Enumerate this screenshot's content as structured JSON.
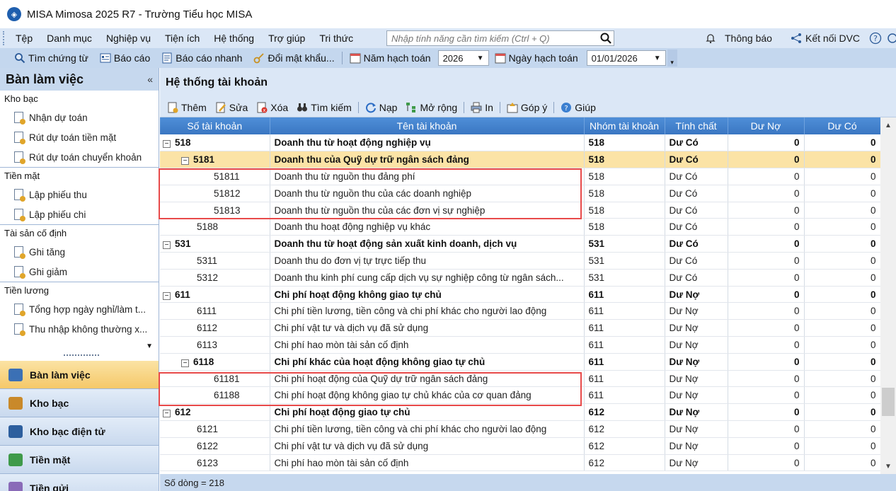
{
  "window": {
    "title": "MISA Mimosa 2025 R7 - Trường Tiểu học MISA"
  },
  "menu": {
    "items": [
      "Tệp",
      "Danh mục",
      "Nghiệp vụ",
      "Tiện ích",
      "Hệ thống",
      "Trợ giúp",
      "Tri thức"
    ],
    "search_placeholder": "Nhập tính năng cần tìm kiếm (Ctrl + Q)",
    "notifications": "Thông báo",
    "connect": "Kết nối DVC"
  },
  "toolbar2": {
    "find_voucher": "Tìm chứng từ",
    "report": "Báo cáo",
    "quick_report": "Báo cáo nhanh",
    "change_password": "Đổi mật khẩu...",
    "fiscal_year_label": "Năm hạch toán",
    "fiscal_year_value": "2026",
    "posting_date_label": "Ngày hạch toán",
    "posting_date_value": "01/01/2026"
  },
  "left_panel": {
    "title": "Bàn làm việc",
    "groups": [
      {
        "name": "Kho bạc",
        "items": [
          "Nhận dự toán",
          "Rút dự toán tiền mặt",
          "Rút dự toán chuyển khoản"
        ]
      },
      {
        "name": "Tiền mặt",
        "items": [
          "Lập phiếu thu",
          "Lập phiếu chi"
        ]
      },
      {
        "name": "Tài sản cố định",
        "items": [
          "Ghi tăng",
          "Ghi giảm"
        ]
      },
      {
        "name": "Tiền lương",
        "items": [
          "Tổng hợp ngày nghỉ/làm t...",
          "Thu nhập không thường x..."
        ]
      }
    ],
    "nav": [
      "Bàn làm việc",
      "Kho bạc",
      "Kho bạc điện tử",
      "Tiền mặt",
      "Tiền gửi"
    ]
  },
  "main": {
    "title": "Hệ thống tài khoản",
    "toolbar": [
      "Thêm",
      "Sửa",
      "Xóa",
      "Tìm kiếm",
      "Nạp",
      "Mở rộng",
      "In",
      "Góp ý",
      "Giúp"
    ],
    "columns": [
      "Số tài khoản",
      "Tên tài khoản",
      "Nhóm tài khoản",
      "Tính chất",
      "Dư Nợ",
      "Dư Có"
    ],
    "rows": [
      {
        "code": "518",
        "name": "Doanh thu từ hoạt động nghiệp vụ",
        "group": "518",
        "nature": "Dư Có",
        "debit": "0",
        "credit": "0"
      },
      {
        "code": "5181",
        "name": "Doanh thu của Quỹ dự trữ ngân sách đảng",
        "group": "518",
        "nature": "Dư Có",
        "debit": "0",
        "credit": "0"
      },
      {
        "code": "51811",
        "name": "Doanh thu từ nguồn thu đảng phí",
        "group": "518",
        "nature": "Dư Có",
        "debit": "0",
        "credit": "0"
      },
      {
        "code": "51812",
        "name": "Doanh thu từ nguồn thu của các doanh nghiệp",
        "group": "518",
        "nature": "Dư Có",
        "debit": "0",
        "credit": "0"
      },
      {
        "code": "51813",
        "name": "Doanh thu từ nguồn thu của các đơn vị sự nghiệp",
        "group": "518",
        "nature": "Dư Có",
        "debit": "0",
        "credit": "0"
      },
      {
        "code": "5188",
        "name": "Doanh thu hoạt động nghiệp vụ khác",
        "group": "518",
        "nature": "Dư Có",
        "debit": "0",
        "credit": "0"
      },
      {
        "code": "531",
        "name": "Doanh thu từ hoạt động sản xuất kinh doanh, dịch vụ",
        "group": "531",
        "nature": "Dư Có",
        "debit": "0",
        "credit": "0"
      },
      {
        "code": "5311",
        "name": "Doanh thu do đơn vị tự trực tiếp thu",
        "group": "531",
        "nature": "Dư Có",
        "debit": "0",
        "credit": "0"
      },
      {
        "code": "5312",
        "name": "Doanh thu kinh phí cung cấp dịch vụ sự nghiệp công từ ngân sách...",
        "group": "531",
        "nature": "Dư Có",
        "debit": "0",
        "credit": "0"
      },
      {
        "code": "611",
        "name": "Chi phí hoạt động không giao tự chủ",
        "group": "611",
        "nature": "Dư Nợ",
        "debit": "0",
        "credit": "0"
      },
      {
        "code": "6111",
        "name": "Chi phí tiền lương, tiền công và chi phí khác cho người lao động",
        "group": "611",
        "nature": "Dư Nợ",
        "debit": "0",
        "credit": "0"
      },
      {
        "code": "6112",
        "name": "Chi phí vật tư và dịch vụ đã sử dụng",
        "group": "611",
        "nature": "Dư Nợ",
        "debit": "0",
        "credit": "0"
      },
      {
        "code": "6113",
        "name": "Chi phí hao mòn tài sản cố định",
        "group": "611",
        "nature": "Dư Nợ",
        "debit": "0",
        "credit": "0"
      },
      {
        "code": "6118",
        "name": "Chi phí khác của hoạt động không giao tự chủ",
        "group": "611",
        "nature": "Dư Nợ",
        "debit": "0",
        "credit": "0"
      },
      {
        "code": "61181",
        "name": "Chi phí hoạt động của Quỹ dự trữ ngân sách đảng",
        "group": "611",
        "nature": "Dư Nợ",
        "debit": "0",
        "credit": "0"
      },
      {
        "code": "61188",
        "name": "Chi phí hoạt động không giao tự chủ khác của cơ quan đảng",
        "group": "611",
        "nature": "Dư Nợ",
        "debit": "0",
        "credit": "0"
      },
      {
        "code": "612",
        "name": "Chi phí hoạt động giao tự chủ",
        "group": "612",
        "nature": "Dư Nợ",
        "debit": "0",
        "credit": "0"
      },
      {
        "code": "6121",
        "name": "Chi phí tiền lương, tiền công và chi phí khác cho người lao động",
        "group": "612",
        "nature": "Dư Nợ",
        "debit": "0",
        "credit": "0"
      },
      {
        "code": "6122",
        "name": "Chi phí vật tư và dịch vụ đã sử dụng",
        "group": "612",
        "nature": "Dư Nợ",
        "debit": "0",
        "credit": "0"
      },
      {
        "code": "6123",
        "name": "Chi phí hao mòn tài sản cố định",
        "group": "612",
        "nature": "Dư Nợ",
        "debit": "0",
        "credit": "0"
      }
    ],
    "status": "Số dòng = 218"
  },
  "colors": {
    "accent": "#3a76c2",
    "selected_row": "#fbe3a6",
    "highlight": "#e84a4a",
    "panel": "#dbe7f6"
  }
}
